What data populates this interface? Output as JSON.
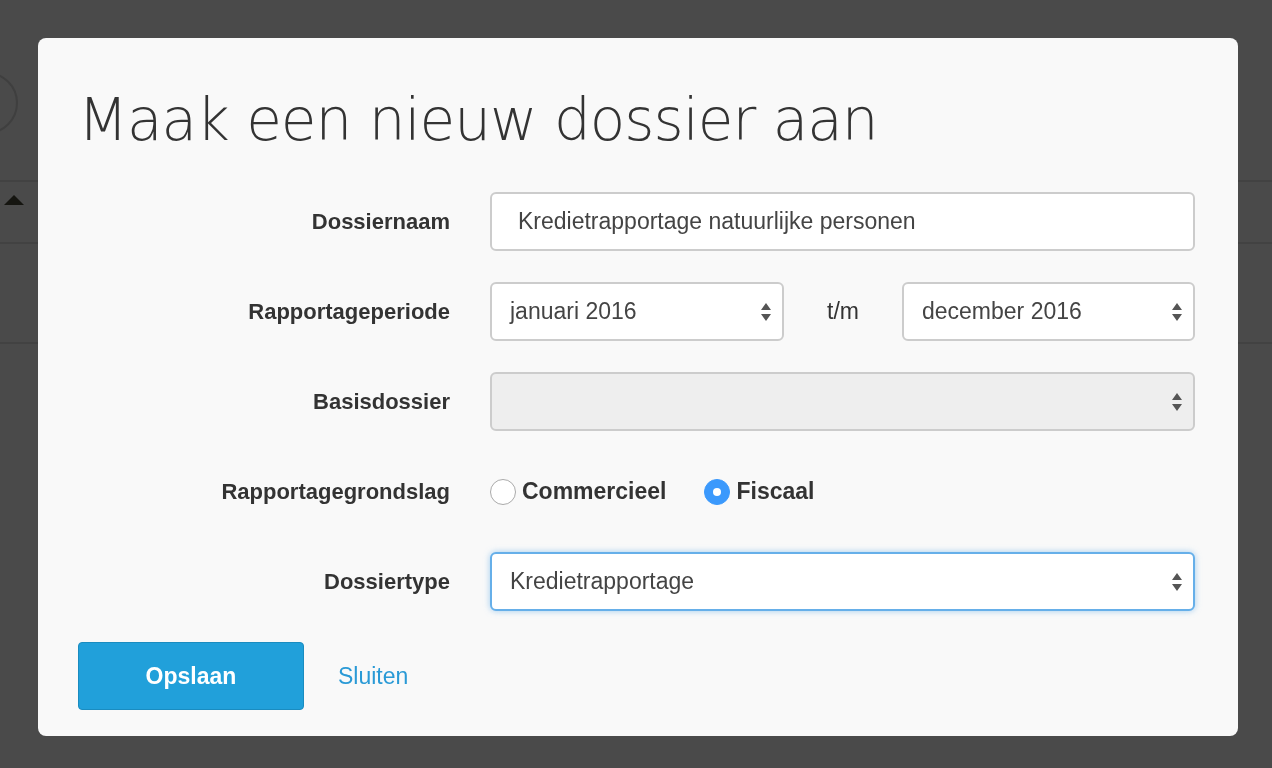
{
  "dialog": {
    "title": "Maak een nieuw dossier aan",
    "fields": [
      {
        "kind": "text",
        "label": "Dossiernaam",
        "value": "Kredietrapportage natuurlijke personen",
        "disabled": false,
        "focused": false
      },
      {
        "kind": "range",
        "label": "Rapportageperiode",
        "from": "januari 2016",
        "separator": "t/m",
        "to": "december 2016"
      },
      {
        "kind": "select",
        "label": "Basisdossier",
        "disabled": true,
        "focused": false
      },
      {
        "kind": "radio",
        "label": "Rapportagegrondslag",
        "options": [
          {
            "label": "Commercieel",
            "selected": false
          },
          {
            "label": "Fiscaal",
            "selected": true
          }
        ]
      },
      {
        "kind": "select",
        "label": "Dossiertype",
        "value": "Kredietrapportage",
        "disabled": false,
        "focused": true
      }
    ],
    "primary_button": "Opslaan",
    "link": "Sluiten"
  }
}
